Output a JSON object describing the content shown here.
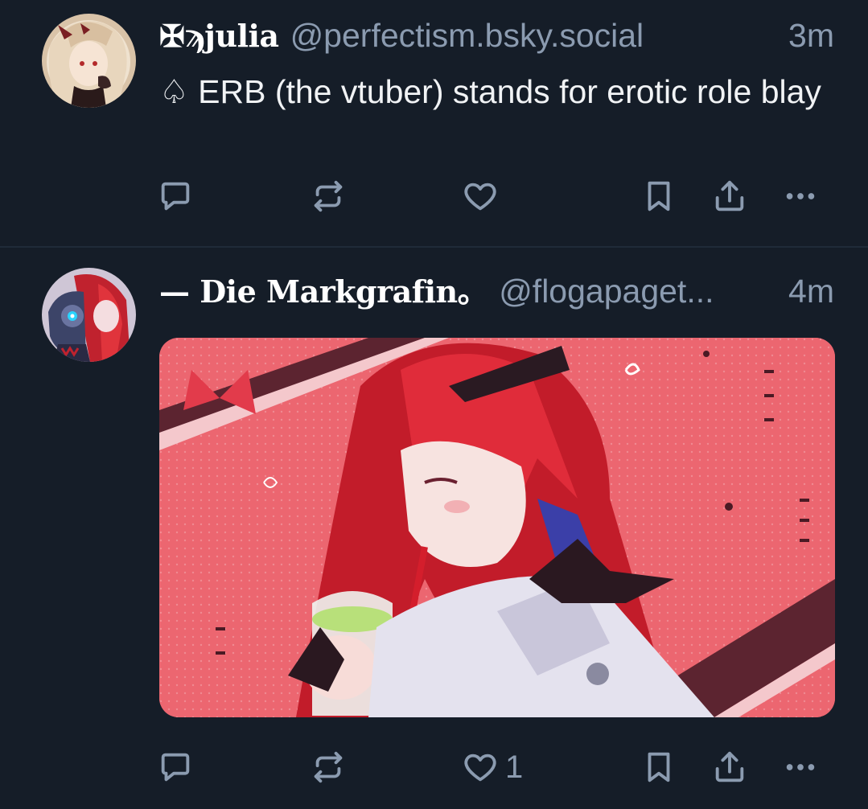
{
  "posts": [
    {
      "display_name": "✠ϡjulia",
      "handle": "@perfectism.bsky.social",
      "time": "3m",
      "text": "♤ ERB (the vtuber) stands for erotic role blay",
      "actions": {
        "reply_count": "",
        "repost_count": "",
        "like_count": ""
      }
    },
    {
      "display_name": "— Die Markgrafin。",
      "handle": "@flogapaget...",
      "time": "4m",
      "media": "anime-artwork-image",
      "actions": {
        "reply_count": "",
        "repost_count": "",
        "like_count": "1"
      }
    }
  ],
  "icons": [
    "reply-icon",
    "repost-icon",
    "like-icon",
    "bookmark-icon",
    "share-icon",
    "more-icon"
  ],
  "colors": {
    "background": "#151d28",
    "muted": "#8b9bb0",
    "text": "#f1f3f5",
    "divider": "#1f2b39"
  }
}
